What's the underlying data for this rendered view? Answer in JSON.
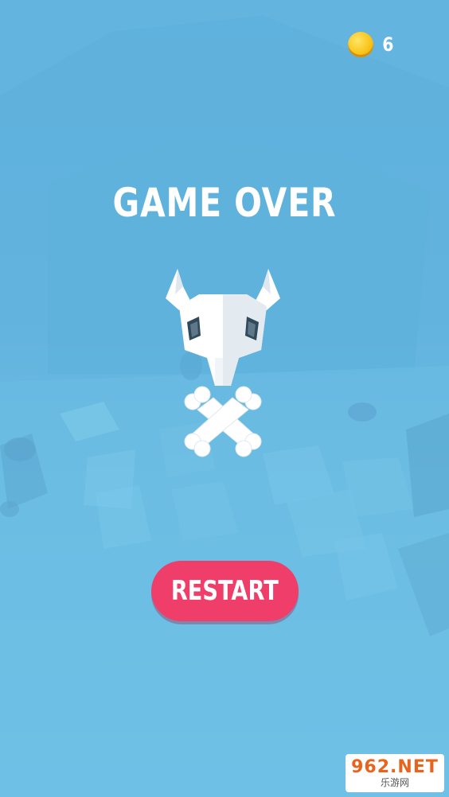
{
  "hud": {
    "coins": "6",
    "coin_icon": "coin-icon"
  },
  "screen": {
    "title": "GAME OVER",
    "emblem_icon": "bull-skull-crossbones-icon"
  },
  "actions": {
    "restart_label": "RESTART"
  },
  "watermark": {
    "top": "962.NET",
    "bottom": "乐游网"
  },
  "colors": {
    "background": "#62b3de",
    "button": "#ef3e69",
    "coin": "#f9c51b",
    "text": "#ffffff"
  }
}
